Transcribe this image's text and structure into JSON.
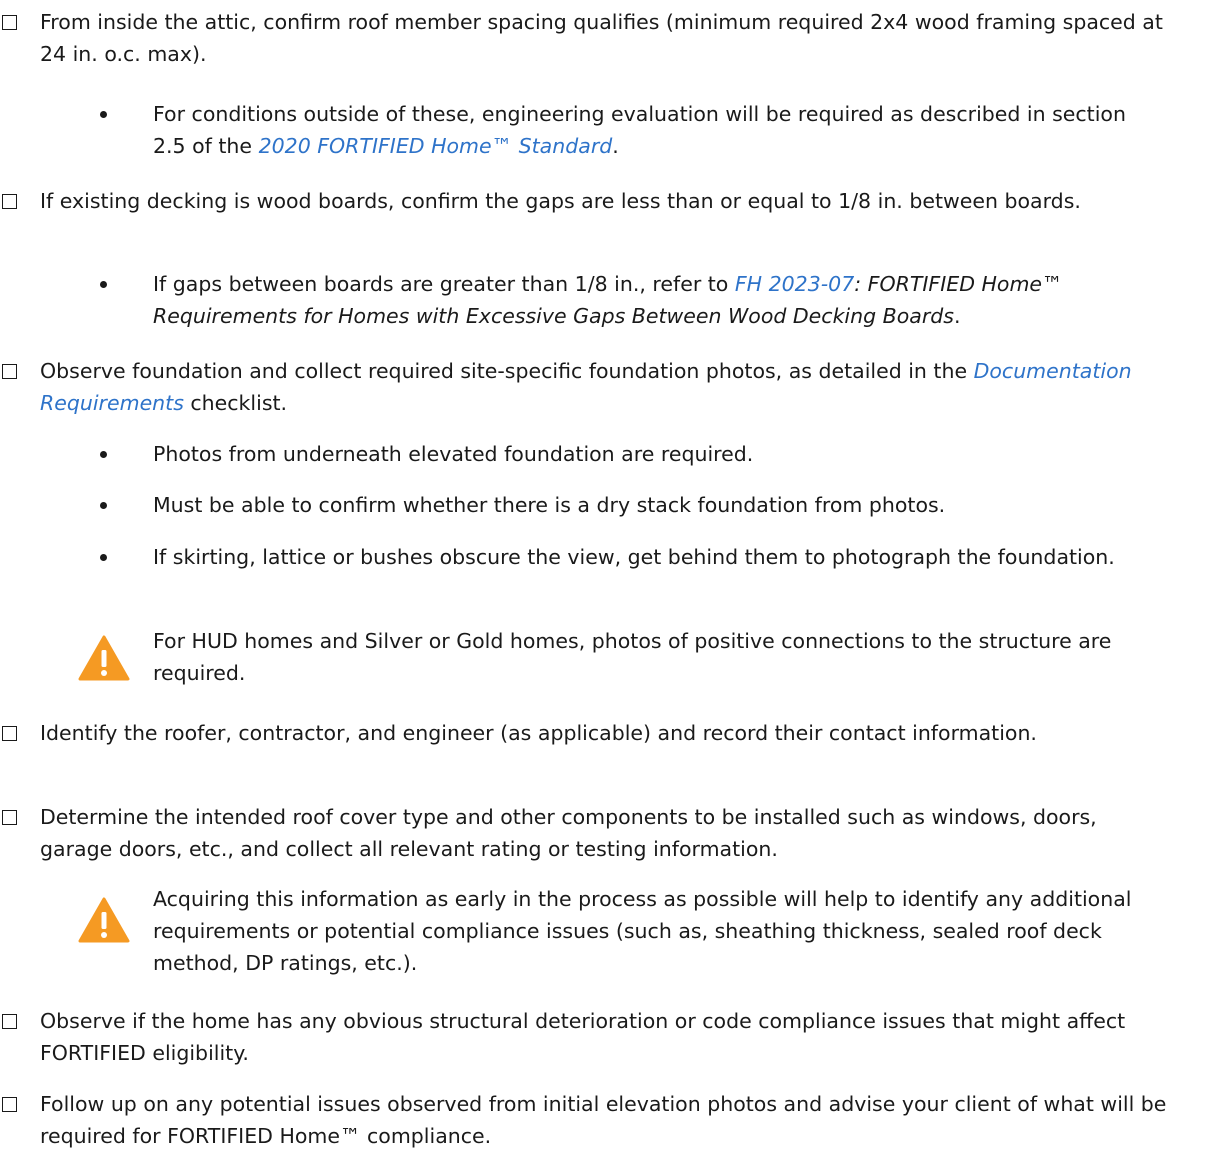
{
  "items": {
    "spacing": {
      "text": "From inside the attic, confirm roof member spacing qualifies (minimum required 2x4 wood framing spaced at 24 in. o.c. max)."
    },
    "spacing_bullet": {
      "pre": "For conditions outside of these, engineering evaluation will be required as described in section 2.5 of the ",
      "link": "2020 FORTIFIED Home™ Standard",
      "post": "."
    },
    "decking": {
      "text": "If existing decking is wood boards, confirm the gaps are less than or equal to 1/8 in. between boards."
    },
    "decking_bullet": {
      "pre": "If gaps between boards are greater than 1/8 in., refer to ",
      "link": "FH 2023-07",
      "post_italic": ": FORTIFIED Home™ Requirements for Homes with Excessive Gaps Between Wood Decking Boards",
      "post": "."
    },
    "foundation": {
      "pre": "Observe foundation and collect required site-specific foundation photos, as detailed in the ",
      "link": "Documentation Requirements",
      "post": " checklist."
    },
    "foundation_bullets": [
      "Photos from underneath elevated foundation are required.",
      "Must be able to confirm whether there is a dry stack foundation from photos.",
      "If skirting, lattice or bushes obscure the view, get behind them to photograph the foundation."
    ],
    "foundation_warning": "For HUD homes and Silver or Gold homes, photos of positive connections to the structure are required.",
    "identify": {
      "text": "Identify the roofer, contractor, and engineer (as applicable) and record their contact information."
    },
    "determine": {
      "text": "Determine the intended roof cover type and other components to be installed such as windows, doors, garage doors, etc., and collect all relevant rating or testing information."
    },
    "determine_warning": "Acquiring this information as early in the process as possible will help to identify any additional requirements or potential compliance issues (such as, sheathing thickness, sealed roof deck method, DP ratings, etc.).",
    "observe": {
      "text": "Observe if the home has any obvious structural deterioration or code compliance issues that might affect FORTIFIED eligibility."
    },
    "followup": {
      "text": "Follow up on any potential issues observed from initial elevation photos and advise your client of what will be required for FORTIFIED Home™ compliance."
    }
  },
  "colors": {
    "text": "#1a1a1a",
    "link": "#2e73c9",
    "warning": "#f59a23"
  }
}
